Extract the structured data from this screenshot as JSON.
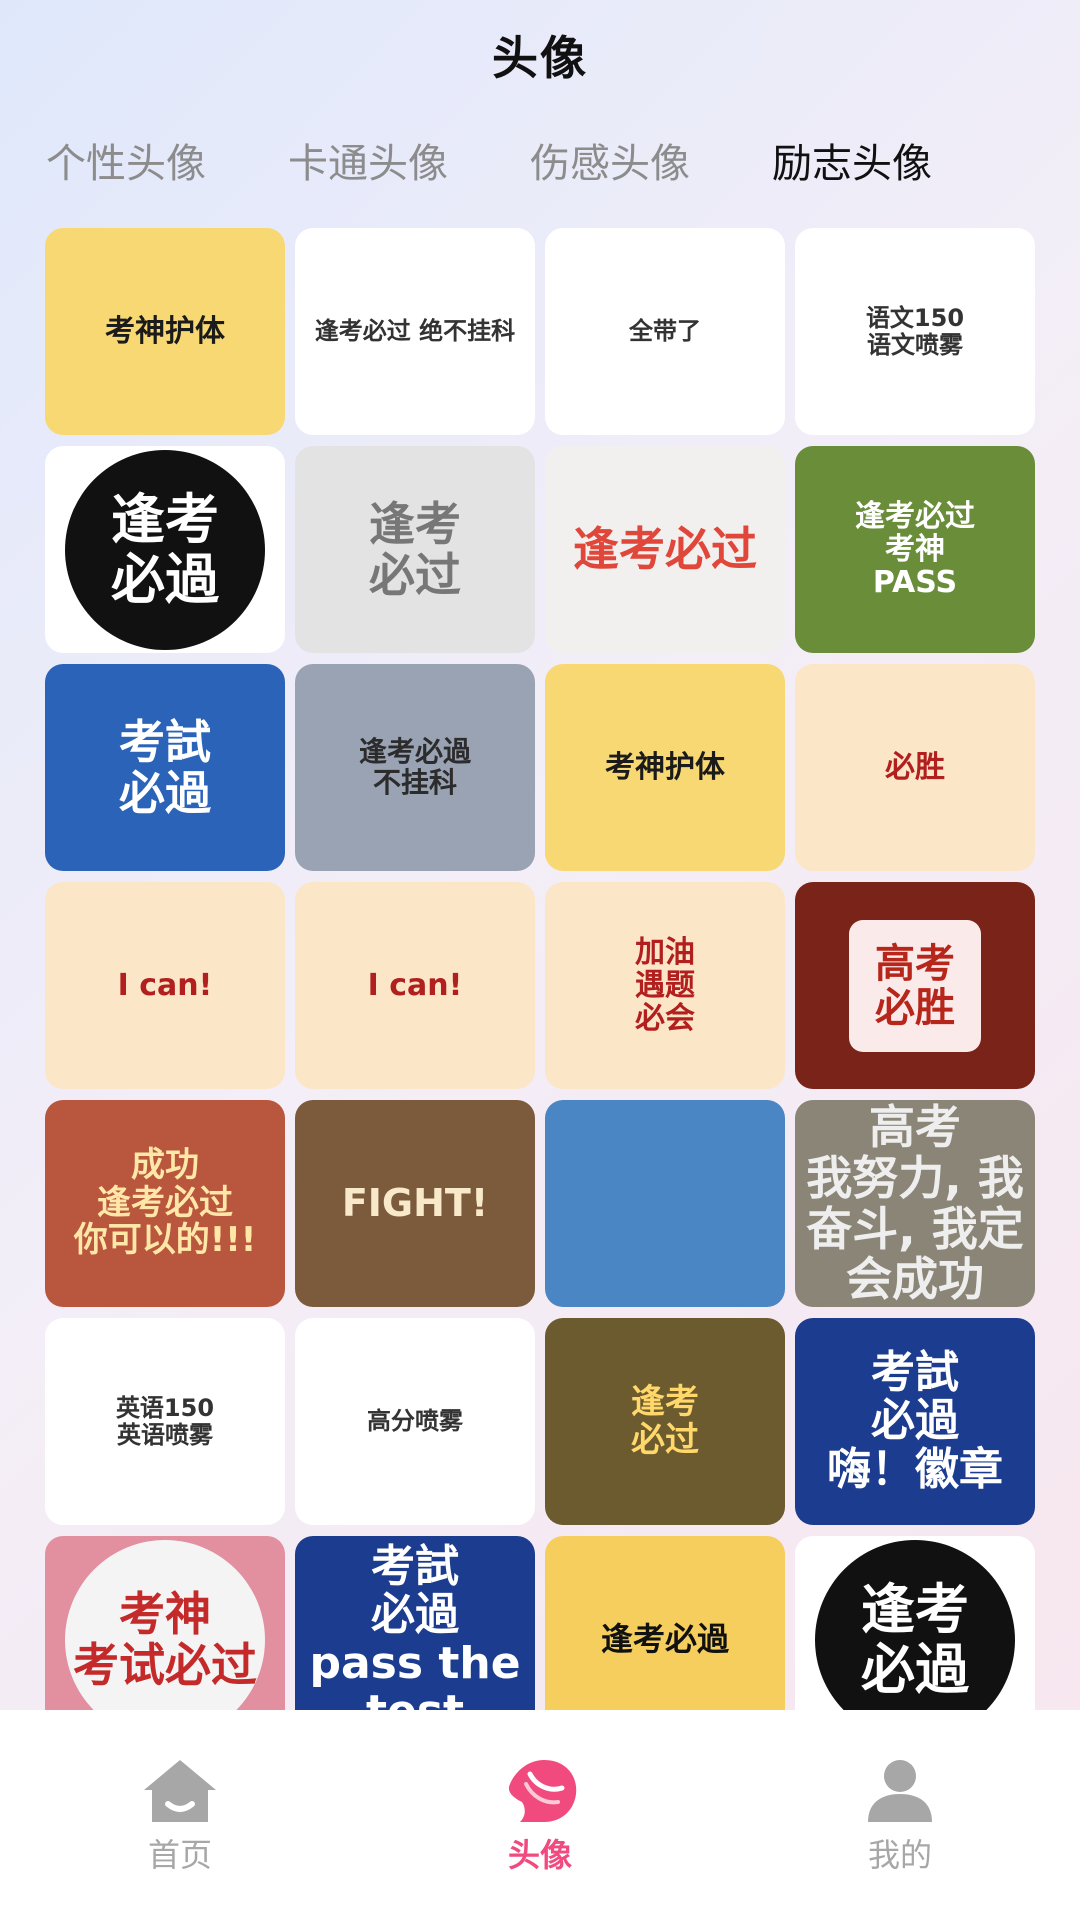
{
  "header": {
    "title": "头像"
  },
  "tabs": [
    {
      "label": "个性头像",
      "active": false
    },
    {
      "label": "卡通头像",
      "active": false
    },
    {
      "label": "伤感头像",
      "active": false
    },
    {
      "label": "励志头像",
      "active": true
    }
  ],
  "tiles": [
    {
      "text": "考神护体",
      "style": "yellow"
    },
    {
      "text": "逢考必过  绝不挂科",
      "style": "white"
    },
    {
      "text": "全带了",
      "style": "white"
    },
    {
      "text": "语文150\n语文喷雾",
      "style": "white"
    },
    {
      "text": "逢考\n必過",
      "style": "circleblack"
    },
    {
      "text": "逢考\n必过",
      "style": "grey"
    },
    {
      "text": "逢考必过",
      "style": "redtext"
    },
    {
      "text": "逢考必过\n考神\nPASS",
      "style": "frame"
    },
    {
      "text": "考試\n必過",
      "style": "blue"
    },
    {
      "text": "逢考必過\n不挂科",
      "style": "silver"
    },
    {
      "text": "考神护体",
      "style": "yellow"
    },
    {
      "text": "必胜",
      "style": "headband"
    },
    {
      "text": "I can!",
      "style": "headband"
    },
    {
      "text": "I can!",
      "style": "headband"
    },
    {
      "text": "加油\n遇题\n必会",
      "style": "headband"
    },
    {
      "text": "高考\n必胜",
      "style": "maroon"
    },
    {
      "text": "成功\n逢考必过\n你可以的!!!",
      "style": "orangepaper"
    },
    {
      "text": "FIGHT!",
      "style": "sketch"
    },
    {
      "text": "",
      "style": "sky"
    },
    {
      "text": "高考\n我努力, 我奋斗, 我定会成功",
      "style": "photo"
    },
    {
      "text": "英语150\n英语喷雾",
      "style": "white"
    },
    {
      "text": "高分喷雾",
      "style": "white"
    },
    {
      "text": "逢考\n必过",
      "style": "gold"
    },
    {
      "text": "考試\n必過\n嗨！徽章",
      "style": "bluebadge"
    },
    {
      "text": "考神\n考试必过",
      "style": "pink"
    },
    {
      "text": "考試\n必過\npass the test",
      "style": "bluebadge"
    },
    {
      "text": "逢考必過",
      "style": "panda"
    },
    {
      "text": "逢考\n必過",
      "style": "circleblack"
    }
  ],
  "bottom_nav": [
    {
      "label": "首页",
      "icon": "home-icon",
      "active": false
    },
    {
      "label": "头像",
      "icon": "avatar-head-icon",
      "active": true
    },
    {
      "label": "我的",
      "icon": "user-icon",
      "active": false
    }
  ],
  "colors": {
    "accent": "#f04a7e",
    "inactive_nav": "#a7a7a7",
    "tab_inactive": "#8c8c8c"
  }
}
